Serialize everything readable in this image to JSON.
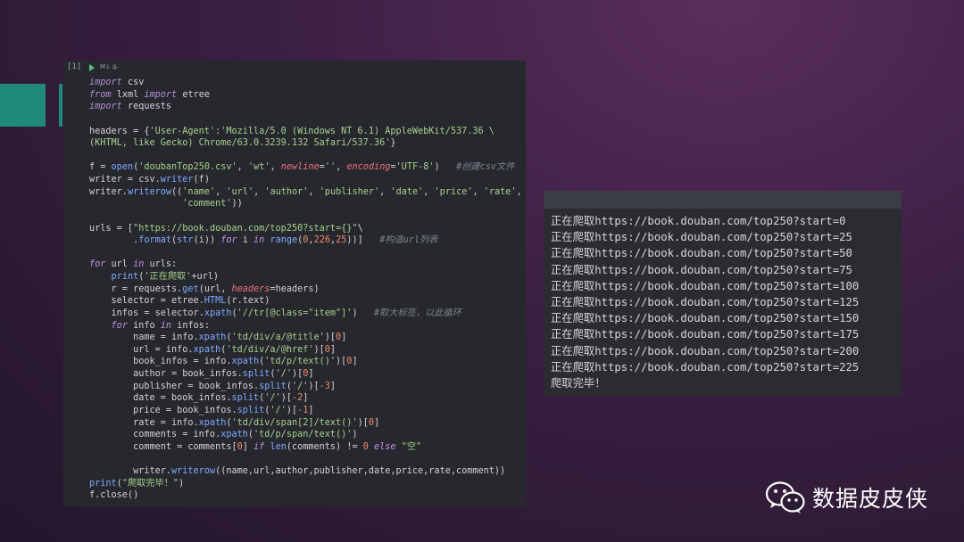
{
  "cell": {
    "exec_count": "[1]",
    "markdown_label": "M↓",
    "code": {
      "imp1_kw": "import",
      "imp1_mod": "csv",
      "imp2_from": "from",
      "imp2_mod": "lxml",
      "imp2_kw": "import",
      "imp2_name": "etree",
      "imp3_kw": "import",
      "imp3_mod": "requests",
      "hdr_pre": "headers = {",
      "hdr_key": "'User-Agent'",
      "hdr_colon": ":",
      "hdr_val1": "'Mozilla/5.0 (Windows NT 6.1) AppleWebKit/537.36 \\",
      "hdr_val2": "(KHTML, like Gecko) Chrome/63.0.3239.132 Safari/537.36'",
      "hdr_end": "}",
      "f_pre": "f = ",
      "f_open": "open",
      "f_p1": "(",
      "f_file": "'doubanTop250.csv'",
      "f_c1": ", ",
      "f_mode": "'wt'",
      "f_c2": ", ",
      "f_nl": "newline",
      "f_eq1": "=",
      "f_nlv": "''",
      "f_c3": ", ",
      "f_enc": "encoding",
      "f_eq2": "=",
      "f_encv": "'UTF-8'",
      "f_p2": ")   ",
      "f_com": "#创建csv文件",
      "w_pre": "writer = csv.",
      "w_fn": "writer",
      "w_arg": "(f)",
      "wr_pre": "writer.",
      "wr_fn": "writerow",
      "wr_p": "((",
      "wr_s1": "'name'",
      "wr_c1": ", ",
      "wr_s2": "'url'",
      "wr_c2": ", ",
      "wr_s3": "'author'",
      "wr_c3": ", ",
      "wr_s4": "'publisher'",
      "wr_c4": ", ",
      "wr_s5": "'date'",
      "wr_c5": ", ",
      "wr_s6": "'price'",
      "wr_c6": ", ",
      "wr_s7": "'rate'",
      "wr_c7": ",",
      "wr2_ind": "                 ",
      "wr2_s": "'comment'",
      "wr2_end": "))",
      "u_pre": "urls = [",
      "u_str": "\"https://book.douban.com/top250?start={}\"",
      "u_bs": "\\",
      "u2_ind": "        .",
      "u2_fmt": "format",
      "u2_p1": "(",
      "u2_strfn": "str",
      "u2_p2": "(i)) ",
      "u2_for": "for",
      "u2_i": " i ",
      "u2_in": "in",
      "u2_sp": " ",
      "u2_range": "range",
      "u2_p3": "(",
      "u2_n1": "0",
      "u2_cm1": ",",
      "u2_n2": "226",
      "u2_cm2": ",",
      "u2_n3": "25",
      "u2_p4": "))]   ",
      "u2_com": "#构造url列表",
      "for1_kw": "for",
      "for1_mid": " url ",
      "for1_in": "in",
      "for1_end": " urls:",
      "p1_ind": "    ",
      "p1_fn": "print",
      "p1_p": "(",
      "p1_s": "'正在爬取'",
      "p1_end": "+url)",
      "r_pre": "    r = requests.",
      "r_fn": "get",
      "r_mid": "(url, ",
      "r_kw": "headers",
      "r_end": "=headers)",
      "sel_pre": "    selector = etree.",
      "sel_fn": "HTML",
      "sel_end": "(r.text)",
      "inf_pre": "    infos = selector.",
      "inf_fn": "xpath",
      "inf_p": "(",
      "inf_s": "'//tr[@class=\"item\"]'",
      "inf_end": ")   ",
      "inf_com": "#取大标签，以此循环",
      "for2_ind": "    ",
      "for2_kw": "for",
      "for2_mid": " info ",
      "for2_in": "in",
      "for2_end": " infos:",
      "nm_pre": "        name = info.",
      "nm_fn": "xpath",
      "nm_p": "(",
      "nm_s": "'td/div/a/@title'",
      "nm_p2": ")[",
      "nm_n": "0",
      "nm_end": "]",
      "ur_pre": "        url = info.",
      "ur_fn": "xpath",
      "ur_p": "(",
      "ur_s": "'td/div/a/@href'",
      "ur_p2": ")[",
      "ur_n": "0",
      "ur_end": "]",
      "bi_pre": "        book_infos = info.",
      "bi_fn": "xpath",
      "bi_p": "(",
      "bi_s": "'td/p/text()'",
      "bi_p2": ")[",
      "bi_n": "0",
      "bi_end": "]",
      "au_pre": "        author = book_infos.",
      "au_fn": "split",
      "au_p": "(",
      "au_s": "'/'",
      "au_p2": ")[",
      "au_n": "0",
      "au_end": "]",
      "pu_pre": "        publisher = book_infos.",
      "pu_fn": "split",
      "pu_p": "(",
      "pu_s": "'/'",
      "pu_p2": ")[",
      "pu_n": "-3",
      "pu_end": "]",
      "da_pre": "        date = book_infos.",
      "da_fn": "split",
      "da_p": "(",
      "da_s": "'/'",
      "da_p2": ")[",
      "da_n": "-2",
      "da_end": "]",
      "pr_pre": "        price = book_infos.",
      "pr_fn": "split",
      "pr_p": "(",
      "pr_s": "'/'",
      "pr_p2": ")[",
      "pr_n": "-1",
      "pr_end": "]",
      "ra_pre": "        rate = info.",
      "ra_fn": "xpath",
      "ra_p": "(",
      "ra_s": "'td/div/span[2]/text()'",
      "ra_p2": ")[",
      "ra_n": "0",
      "ra_end": "]",
      "cs_pre": "        comments = info.",
      "cs_fn": "xpath",
      "cs_p": "(",
      "cs_s": "'td/p/span/text()'",
      "cs_end": ")",
      "cm_pre": "        comment = comments[",
      "cm_n0": "0",
      "cm_mid": "] ",
      "cm_if": "if",
      "cm_sp": " ",
      "cm_len": "len",
      "cm_mid2": "(comments) != ",
      "cm_n1": "0",
      "cm_sp2": " ",
      "cm_else": "else",
      "cm_sp3": " ",
      "cm_s": "\"空\"",
      "ww_pre": "        writer.",
      "ww_fn": "writerow",
      "ww_end": "((name,url,author,publisher,date,price,rate,comment))",
      "pe_fn": "print",
      "pe_p": "(",
      "pe_s": "\"爬取完毕！\"",
      "pe_end": ")",
      "fc": "f.close()"
    }
  },
  "output": {
    "lines": [
      "正在爬取https://book.douban.com/top250?start=0",
      "正在爬取https://book.douban.com/top250?start=25",
      "正在爬取https://book.douban.com/top250?start=50",
      "正在爬取https://book.douban.com/top250?start=75",
      "正在爬取https://book.douban.com/top250?start=100",
      "正在爬取https://book.douban.com/top250?start=125",
      "正在爬取https://book.douban.com/top250?start=150",
      "正在爬取https://book.douban.com/top250?start=175",
      "正在爬取https://book.douban.com/top250?start=200",
      "正在爬取https://book.douban.com/top250?start=225",
      "爬取完毕！"
    ]
  },
  "watermark": {
    "text": "数据皮皮侠",
    "icon": "wechat-icon"
  },
  "colors": {
    "accent": "#1f8a78",
    "run": "#4ec97f"
  }
}
